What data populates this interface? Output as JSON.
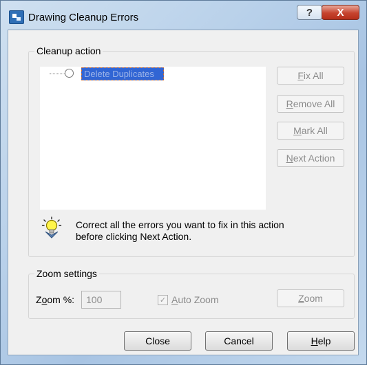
{
  "window": {
    "title": "Drawing Cleanup Errors",
    "help_glyph": "?",
    "close_glyph": "X"
  },
  "cleanup_group": {
    "label": "Cleanup action",
    "tree_node_label": "Delete Duplicates",
    "buttons": {
      "fix_all": {
        "pre": "",
        "key": "F",
        "post": "ix All"
      },
      "remove_all": {
        "pre": "",
        "key": "R",
        "post": "emove All"
      },
      "mark_all": {
        "pre": "",
        "key": "M",
        "post": "ark All"
      },
      "next_action": {
        "pre": "",
        "key": "N",
        "post": "ext Action"
      }
    },
    "hint_line1": "Correct all the errors you want to fix in this action",
    "hint_line2": "before clicking Next Action."
  },
  "zoom_group": {
    "label": "Zoom settings",
    "zoom_label_pre": "Z",
    "zoom_label_key": "o",
    "zoom_label_post": "om %:",
    "zoom_value": "100",
    "auto_zoom_checked": true,
    "auto_zoom_key": "A",
    "auto_zoom_rest": "uto Zoom",
    "zoom_button_key": "Z",
    "zoom_button_rest": "oom"
  },
  "footer": {
    "close_label": "Close",
    "cancel_label": "Cancel",
    "help_key": "H",
    "help_rest": "elp"
  },
  "icons": {
    "app": "app-icon",
    "hint": "lightbulb-icon",
    "tree_node": "radio-node-icon"
  }
}
